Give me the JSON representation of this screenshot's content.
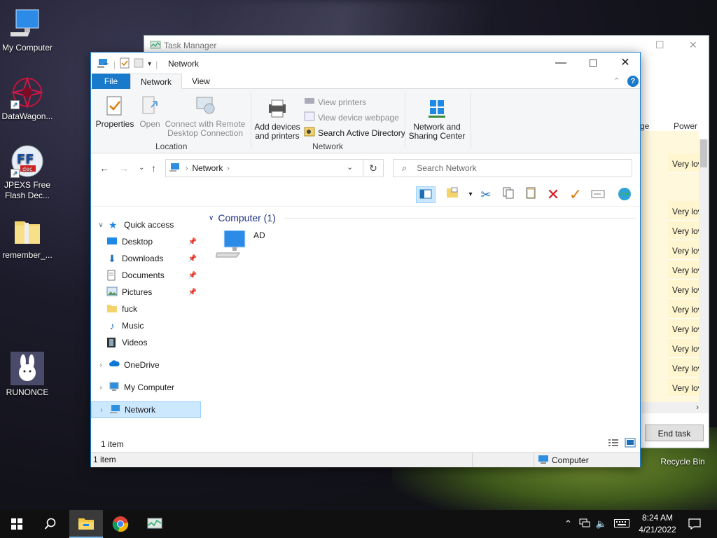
{
  "desktop": {
    "icons": [
      {
        "label": "My Computer"
      },
      {
        "label": "DataWagon..."
      },
      {
        "label": "JPEXS Free Flash Dec..."
      },
      {
        "label": "remember_..."
      },
      {
        "label": "RUNONCE"
      },
      {
        "label": "Recycle Bin"
      }
    ]
  },
  "taskmgr": {
    "title": "Task Manager",
    "col_partial": "ge",
    "col_power": "Power usa",
    "rows": [
      "Very lov",
      "",
      "Very lov",
      "Very lov",
      "Very lov",
      "Very lov",
      "Very lov",
      "Very lov",
      "Very lov",
      "Very lov",
      "Very lov",
      "Very lov"
    ],
    "end_task": "End task"
  },
  "explorer": {
    "title": "Network",
    "tabs": {
      "file": "File",
      "network": "Network",
      "view": "View"
    },
    "ribbon": {
      "properties": "Properties",
      "open": "Open",
      "connect_remote": "Connect with Remote Desktop Connection",
      "location_group": "Location",
      "add_devices": "Add devices and printers",
      "view_printers": "View printers",
      "view_device_webpage": "View device webpage",
      "search_ad": "Search Active Directory",
      "network_group": "Network",
      "network_sharing": "Network and Sharing Center"
    },
    "address": {
      "segment": "Network"
    },
    "search": {
      "placeholder": "Search Network"
    },
    "nav": {
      "quick_access": "Quick access",
      "desktop": "Desktop",
      "downloads": "Downloads",
      "documents": "Documents",
      "pictures": "Pictures",
      "fuck": "fuck",
      "music": "Music",
      "videos": "Videos",
      "onedrive": "OneDrive",
      "my_computer": "My Computer",
      "network": "Network"
    },
    "content": {
      "group_header": "Computer (1)",
      "item_name": "AD"
    },
    "status": {
      "count": "1 item",
      "bottom_count": "1 item",
      "zone": "Computer"
    }
  },
  "taskbar": {
    "time": "8:24 AM",
    "date": "4/21/2022"
  },
  "colors": {
    "accent": "#1979ca",
    "selection": "#cce8ff"
  }
}
